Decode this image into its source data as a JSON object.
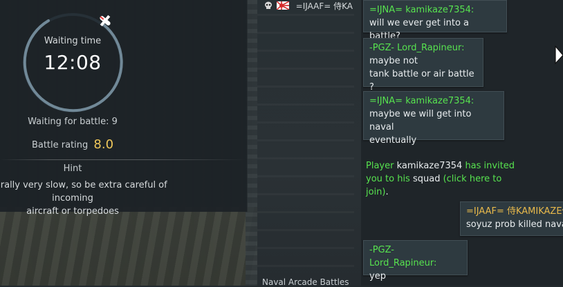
{
  "wait_panel": {
    "title": "Waiting time",
    "time": "12:08",
    "waiting_for_battle": "Waiting for battle: 9",
    "battle_rating_label": "Battle rating",
    "battle_rating_value": "8.0",
    "hint_title": "Hint",
    "hint_line1": "generally very slow, so be extra careful of incoming",
    "hint_line2": "aircraft or torpedoes"
  },
  "player_strip": {
    "name": "=IJAAF= 侍KA"
  },
  "mode_label": "Naval Arcade Battles",
  "chat": {
    "messages": [
      {
        "sender": "=IJNA= kamikaze7354:",
        "lines": [
          "will we ever get into a battle?"
        ]
      },
      {
        "sender": "-PGZ- Lord_Rapineur:",
        "lines": [
          "maybe not",
          "tank battle or air battle ?"
        ]
      },
      {
        "sender": "=IJNA= kamikaze7354:",
        "lines": [
          "maybe we will get into naval",
          "eventually"
        ]
      },
      {
        "sender": "=IJAAF= 侍KAMIKAZE侍",
        "lines": [
          "soyuz prob killed naval"
        ]
      },
      {
        "sender": "-PGZ- Lord_Rapineur:",
        "lines": [
          "yep"
        ]
      }
    ],
    "invite": {
      "part1": "Player ",
      "player": "kamikaze7354",
      "part2": " has invited you to his ",
      "squad": "squad",
      "part3": " (click here to join)",
      "part4": "."
    }
  },
  "colors": {
    "accent_green": "#57e34f",
    "accent_gold": "#e8b94b",
    "battle_rating": "#f0c85a"
  }
}
